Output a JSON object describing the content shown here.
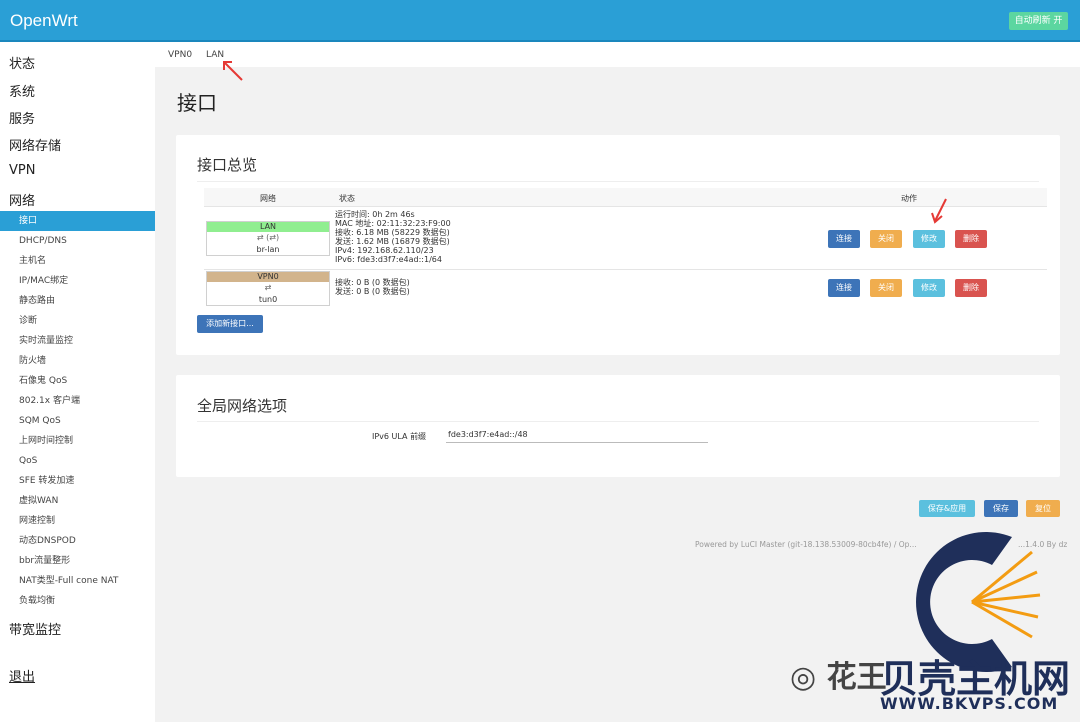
{
  "header": {
    "brand": "OpenWrt",
    "autorefresh": "自动刷新 开"
  },
  "sidebar": {
    "top_items": [
      "状态",
      "系统",
      "服务",
      "网络存储",
      "VPN",
      "网络"
    ],
    "sub_items": [
      "接口",
      "DHCP/DNS",
      "主机名",
      "IP/MAC绑定",
      "静态路由",
      "诊断",
      "实时流量监控",
      "防火墙",
      "石像鬼 QoS",
      "802.1x 客户端",
      "SQM QoS",
      "上网时间控制",
      "QoS",
      "SFE 转发加速",
      "虚拟WAN",
      "网速控制",
      "动态DNSPOD",
      "bbr流量整形",
      "NAT类型-Full cone NAT",
      "负载均衡"
    ],
    "bandwidth": "带宽监控",
    "logout": "退出"
  },
  "tabs": {
    "vpn0": "VPN0",
    "lan": "LAN"
  },
  "page_title": "接口",
  "overview": {
    "title": "接口总览",
    "headers": {
      "network": "网络",
      "status": "状态",
      "actions": "动作"
    },
    "rows": [
      {
        "name": "LAN",
        "icons": "⇄ (⇄)",
        "device": "br-lan",
        "status_lines": [
          "运行时间: 0h 2m 46s",
          "MAC 地址: 02:11:32:23:F9:00",
          "接收: 6.18 MB (58229 数据包)",
          "发送: 1.62 MB (16879 数据包)",
          "IPv4: 192.168.62.110/23",
          "IPv6: fde3:d3f7:e4ad::1/64"
        ]
      },
      {
        "name": "VPN0",
        "icons": "⇄",
        "device": "tun0",
        "status_lines": [
          "接收: 0 B (0 数据包)",
          "发送: 0 B (0 数据包)"
        ]
      }
    ],
    "buttons": {
      "connect": "连接",
      "close": "关闭",
      "edit": "修改",
      "delete": "删除"
    },
    "add": "添加新接口..."
  },
  "global": {
    "title": "全局网络选项",
    "ula_label": "IPv6 ULA 前缀",
    "ula_value": "fde3:d3f7:e4ad::/48"
  },
  "actions": {
    "save_apply": "保存&应用",
    "save": "保存",
    "reset": "复位"
  },
  "footer": "Powered by LuCI Master (git-18.138.53009-80cb4fe) / Op...",
  "footer_tail": "...1.4.0 By dz",
  "watermark": {
    "wechat": "花王",
    "cn": "贝壳主机网",
    "url": "WWW.BKVPS.COM"
  },
  "colors": {
    "header": "#2a9fd6",
    "active": "#2a9fd6",
    "lan": "#90ee90",
    "vpn": "#d2b48c"
  }
}
